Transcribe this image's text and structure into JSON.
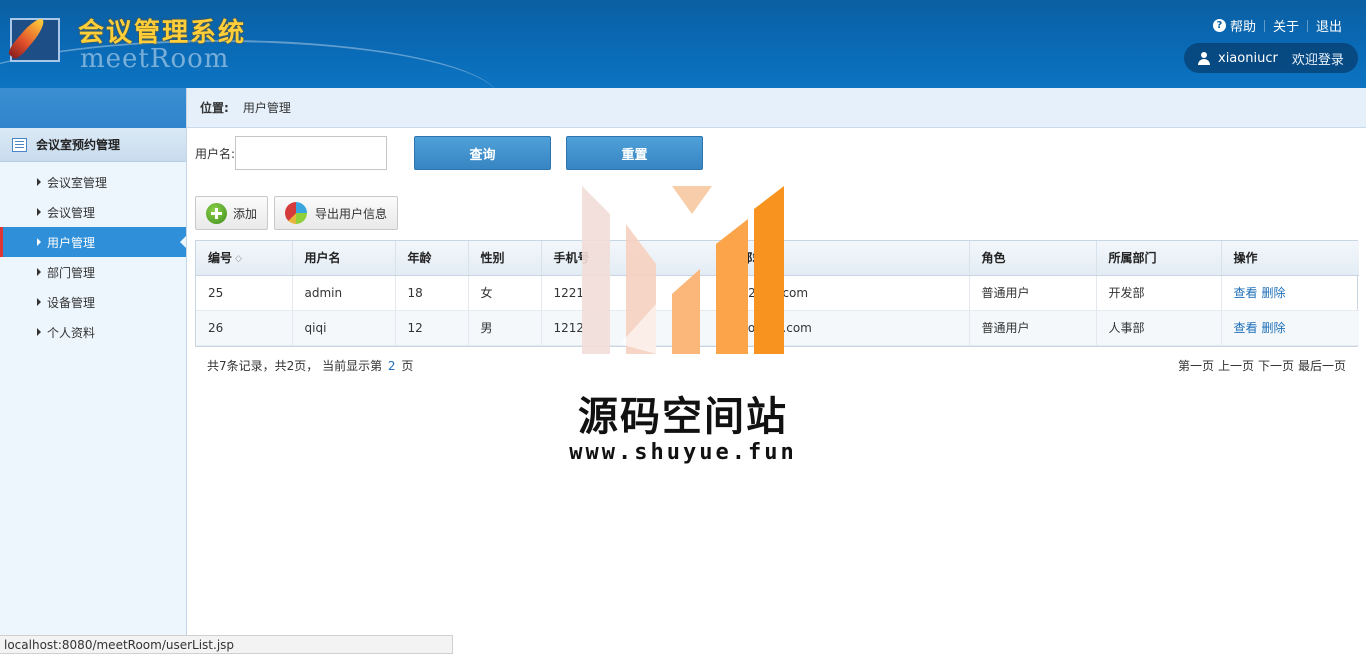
{
  "header": {
    "title": "会议管理系统",
    "subtitle": "meetRoom",
    "links": [
      {
        "label": "帮助",
        "icon": "help-icon"
      },
      {
        "label": "关于"
      },
      {
        "label": "退出"
      }
    ],
    "user": {
      "name": "xiaoniucr",
      "welcome": "欢迎登录"
    }
  },
  "sidebar": {
    "group": "会议室预约管理",
    "items": [
      {
        "label": "会议室管理",
        "active": false
      },
      {
        "label": "会议管理",
        "active": false
      },
      {
        "label": "用户管理",
        "active": true
      },
      {
        "label": "部门管理",
        "active": false
      },
      {
        "label": "设备管理",
        "active": false
      },
      {
        "label": "个人资料",
        "active": false
      }
    ]
  },
  "breadcrumb": {
    "label": "位置:",
    "current": "用户管理"
  },
  "search": {
    "label": "用户名:",
    "value": "",
    "query_label": "查询",
    "reset_label": "重置"
  },
  "toolbar": {
    "add_label": "添加",
    "export_label": "导出用户信息"
  },
  "table": {
    "columns": [
      "编号",
      "用户名",
      "年龄",
      "性别",
      "手机号",
      "邮箱",
      "角色",
      "所属部门",
      "操作"
    ],
    "rows": [
      {
        "id": "25",
        "username": "admin",
        "age": "18",
        "gender": "女",
        "phone": "1221",
        "email": "123qq.com",
        "role": "普通用户",
        "dept": "开发部",
        "view": "查看",
        "delete": "删除"
      },
      {
        "id": "26",
        "username": "qiqi",
        "age": "12",
        "gender": "男",
        "phone": "1212",
        "email": "ao@qq.com",
        "role": "普通用户",
        "dept": "人事部",
        "view": "查看",
        "delete": "删除"
      }
    ]
  },
  "pager": {
    "summary_prefix": "共7条记录，共2页，  当前显示第",
    "current": "2",
    "summary_suffix": "页",
    "first": "第一页",
    "prev": "上一页",
    "next": "下一页",
    "last": "最后一页"
  },
  "watermark": {
    "title": "源码空间站",
    "url": "www.shuyue.fun"
  },
  "statusbar": {
    "url": "localhost:8080/meetRoom/userList.jsp"
  },
  "colors": {
    "header": "#0a6ab6",
    "active_nav": "#2f8fd8",
    "button": "#3785c2",
    "link": "#1e6fb8"
  }
}
